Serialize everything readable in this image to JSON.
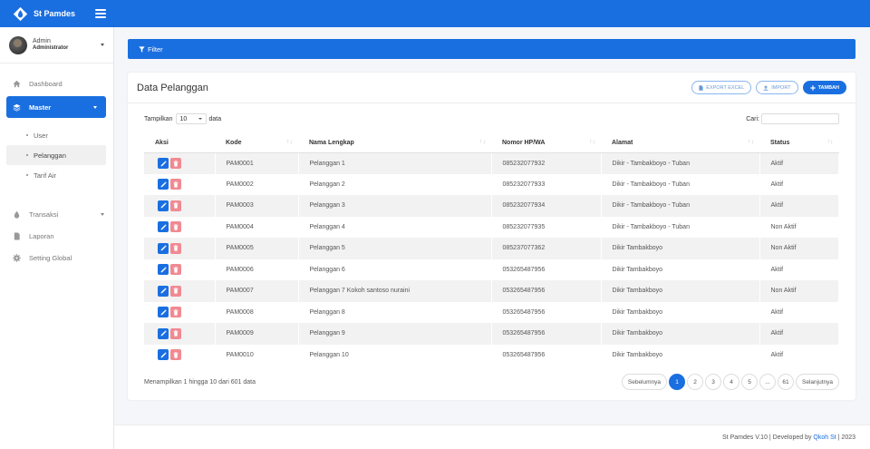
{
  "app": {
    "name": "St Pamdes"
  },
  "user": {
    "name": "Admin",
    "role": "Administrator"
  },
  "nav": {
    "dashboard": "Dashboard",
    "master": "Master",
    "master_sub": [
      "User",
      "Pelanggan",
      "Tarif Air"
    ],
    "transaksi": "Transaksi",
    "laporan": "Laporan",
    "setting": "Setting Global"
  },
  "filter": {
    "label": "Filter"
  },
  "card": {
    "title": "Data Pelanggan",
    "export_label": "EXPORT EXCEL",
    "import_label": "IMPORT",
    "add_label": "TAMBAH"
  },
  "controls": {
    "show_prefix": "Tampilkan",
    "show_value": "10",
    "show_suffix": "data",
    "search_label": "Cari:",
    "search_value": ""
  },
  "table": {
    "headers": [
      "Aksi",
      "Kode",
      "Nama Lengkap",
      "Nomor HP/WA",
      "Alamat",
      "Status"
    ],
    "rows": [
      [
        "PAM0001",
        "Pelanggan 1",
        "085232077932",
        "Dikir - Tambakboyo - Tuban",
        "Aktif"
      ],
      [
        "PAM0002",
        "Pelanggan 2",
        "085232077933",
        "Dikir - Tambakboyo - Tuban",
        "Aktif"
      ],
      [
        "PAM0003",
        "Pelanggan 3",
        "085232077934",
        "Dikir - Tambakboyo - Tuban",
        "Aktif"
      ],
      [
        "PAM0004",
        "Pelanggan 4",
        "085232077935",
        "Dikir - Tambakboyo - Tuban",
        "Non Aktif"
      ],
      [
        "PAM0005",
        "Pelanggan 5",
        "085237077362",
        "Dikir Tambakboyo",
        "Non Aktif"
      ],
      [
        "PAM0006",
        "Pelanggan 6",
        "053265487956",
        "Dikir Tambakboyo",
        "Aktif"
      ],
      [
        "PAM0007",
        "Pelanggan 7 Kokoh santoso nuraini",
        "053265487956",
        "Dikir Tambakboyo",
        "Non Aktif"
      ],
      [
        "PAM0008",
        "Pelanggan 8",
        "053265487956",
        "Dikir Tambakboyo",
        "Aktif"
      ],
      [
        "PAM0009",
        "Pelanggan 9",
        "053265487956",
        "Dikir Tambakboyo",
        "Aktif"
      ],
      [
        "PAM0010",
        "Pelanggan 10",
        "053265487956",
        "Dikir Tambakboyo",
        "Aktif"
      ]
    ]
  },
  "info": {
    "text": "Menampilkan 1 hingga 10 dari 601 data"
  },
  "pagination": {
    "prev": "Sebelumnya",
    "pages": [
      "1",
      "2",
      "3",
      "4",
      "5",
      "...",
      "61"
    ],
    "active": "1",
    "next": "Selanjutnya"
  },
  "footer": {
    "prefix": "St Pamdes V.10 | Developed by ",
    "link": "Qkoh St",
    "suffix": " | 2023"
  },
  "colors": {
    "primary": "#1a6fe0",
    "delete": "#f08a92",
    "stripe": "#f2f2f2"
  },
  "icons": {
    "dashboard": "home-icon",
    "master": "layers-icon",
    "transaksi": "drop-icon",
    "laporan": "file-icon",
    "setting": "gear-icon",
    "filter": "funnel-icon",
    "edit": "pencil-icon",
    "delete": "trash-icon"
  }
}
